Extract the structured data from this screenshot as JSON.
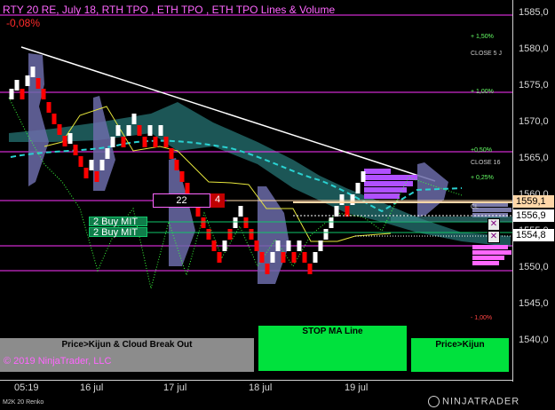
{
  "header": {
    "title": "RTY 20 RE, July 18, RTH TPO , ETH TPO , ETH TPO Lines & Volume",
    "change_pct": "-0,08%"
  },
  "price_axis": {
    "ticks": [
      "1585,0",
      "1580,0",
      "1575,0",
      "1570,0",
      "1565,0",
      "1560,0",
      "1555,0",
      "1550,0",
      "1545,0",
      "1540,0"
    ],
    "last_price": "1556,9",
    "upper_price": "1559,1",
    "lower_price": "1554,8"
  },
  "time_axis": {
    "ticks": [
      "05:19",
      "16 jul",
      "17 jul",
      "18 jul",
      "19 jul"
    ]
  },
  "right_labels": {
    "plus_1_50": "+ 1,50%",
    "close_5": "CLOSE 5 J",
    "plus_1_00": "+ 1,00%",
    "plus_0_50": "+0,50%",
    "close_16": "CLOSE 16",
    "plus_0_25": "+ 0,25%",
    "cl": "CL",
    "minus_1_00": "- 1,00%"
  },
  "orders": {
    "qty": "22",
    "qty_badge": "4",
    "buy_mit_1": "2 Buy MIT",
    "buy_mit_2": "2 Buy MIT"
  },
  "buttons": {
    "price_kijun_cloud": "Price>Kijun & Cloud Break Out",
    "stop_ma_line": "STOP MA Line",
    "price_kijun": "Price>Kijun"
  },
  "footer": {
    "copyright": "© 2019 NinjaTrader, LLC",
    "instrument": "M2K 20 Renko",
    "logo": "NINJATRADER"
  },
  "colors": {
    "background": "#000000",
    "up_brick": "#ffffff",
    "down_brick": "#ff0000",
    "magenta_lines": "#ff33ff",
    "cloud": "#1f5f5f",
    "kijun": "#2ad2d2",
    "buttons_green": "#00e13d",
    "buttons_gray": "#8c8c8c"
  }
}
